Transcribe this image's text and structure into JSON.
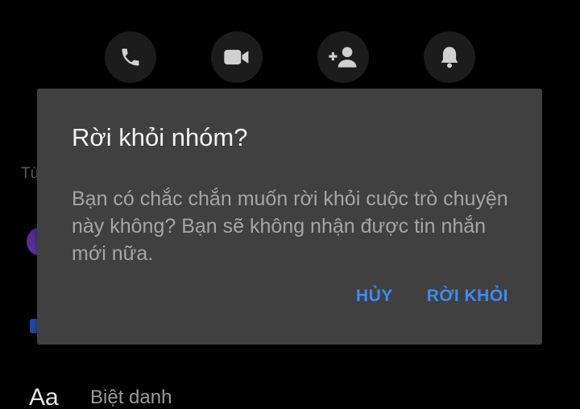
{
  "actions": [
    {
      "name": "call",
      "icon": "phone-icon"
    },
    {
      "name": "video",
      "icon": "video-camera-icon"
    },
    {
      "name": "add-member",
      "icon": "add-person-icon"
    },
    {
      "name": "notifications",
      "icon": "bell-icon"
    }
  ],
  "background": {
    "section_label": "Tù",
    "composer_icon_label": "Aa",
    "nickname_label": "Biệt danh"
  },
  "dialog": {
    "title": "Rời khỏi nhóm?",
    "message": "Bạn có chắc chắn muốn rời khỏi cuộc trò chuyện này không? Bạn sẽ không nhận được tin nhắn mới nữa.",
    "cancel_label": "HỦY",
    "leave_label": "RỜI KHỎI"
  },
  "colors": {
    "background": "#000000",
    "dialog_background": "#404040",
    "accent": "#3d8bf2",
    "title_text": "#f2f2f2",
    "message_text": "#a5a5a5",
    "action_circle": "#1c1c1c",
    "icon": "#d0d0d0"
  }
}
